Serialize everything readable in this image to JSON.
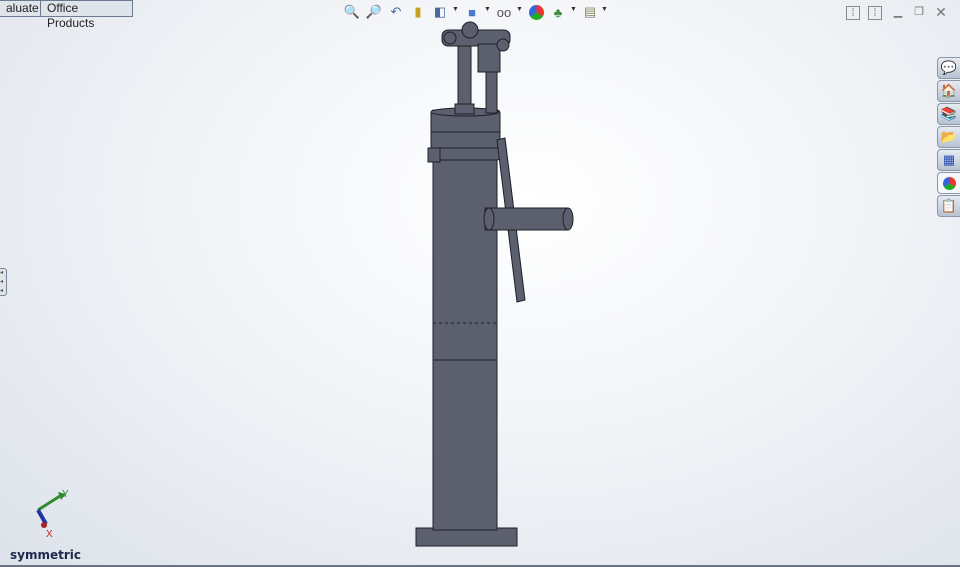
{
  "tabs": [
    {
      "label": "aluate"
    },
    {
      "label": "Office Products"
    }
  ],
  "heads_up_toolbar": [
    "zoom-to-fit-icon",
    "zoom-to-area-icon",
    "previous-view-icon",
    "section-view-icon",
    "view-orientation-icon",
    "display-style-icon",
    "hide-show-items-icon",
    "edit-appearance-icon",
    "apply-scene-icon",
    "view-settings-icon"
  ],
  "window_controls": [
    "tile-left-icon",
    "tile-right-icon",
    "minimize-icon",
    "restore-icon",
    "close-icon"
  ],
  "task_pane": [
    "solidworks-resources-icon",
    "design-library-icon",
    "file-explorer-icon",
    "folder-icon",
    "view-palette-icon",
    "appearances-icon",
    "custom-properties-icon"
  ],
  "triad": {
    "y_label": "Y",
    "x_label": "X"
  },
  "view_label": "symmetric",
  "colors": {
    "model": "#5b5f6e",
    "edge": "#1e2028"
  }
}
